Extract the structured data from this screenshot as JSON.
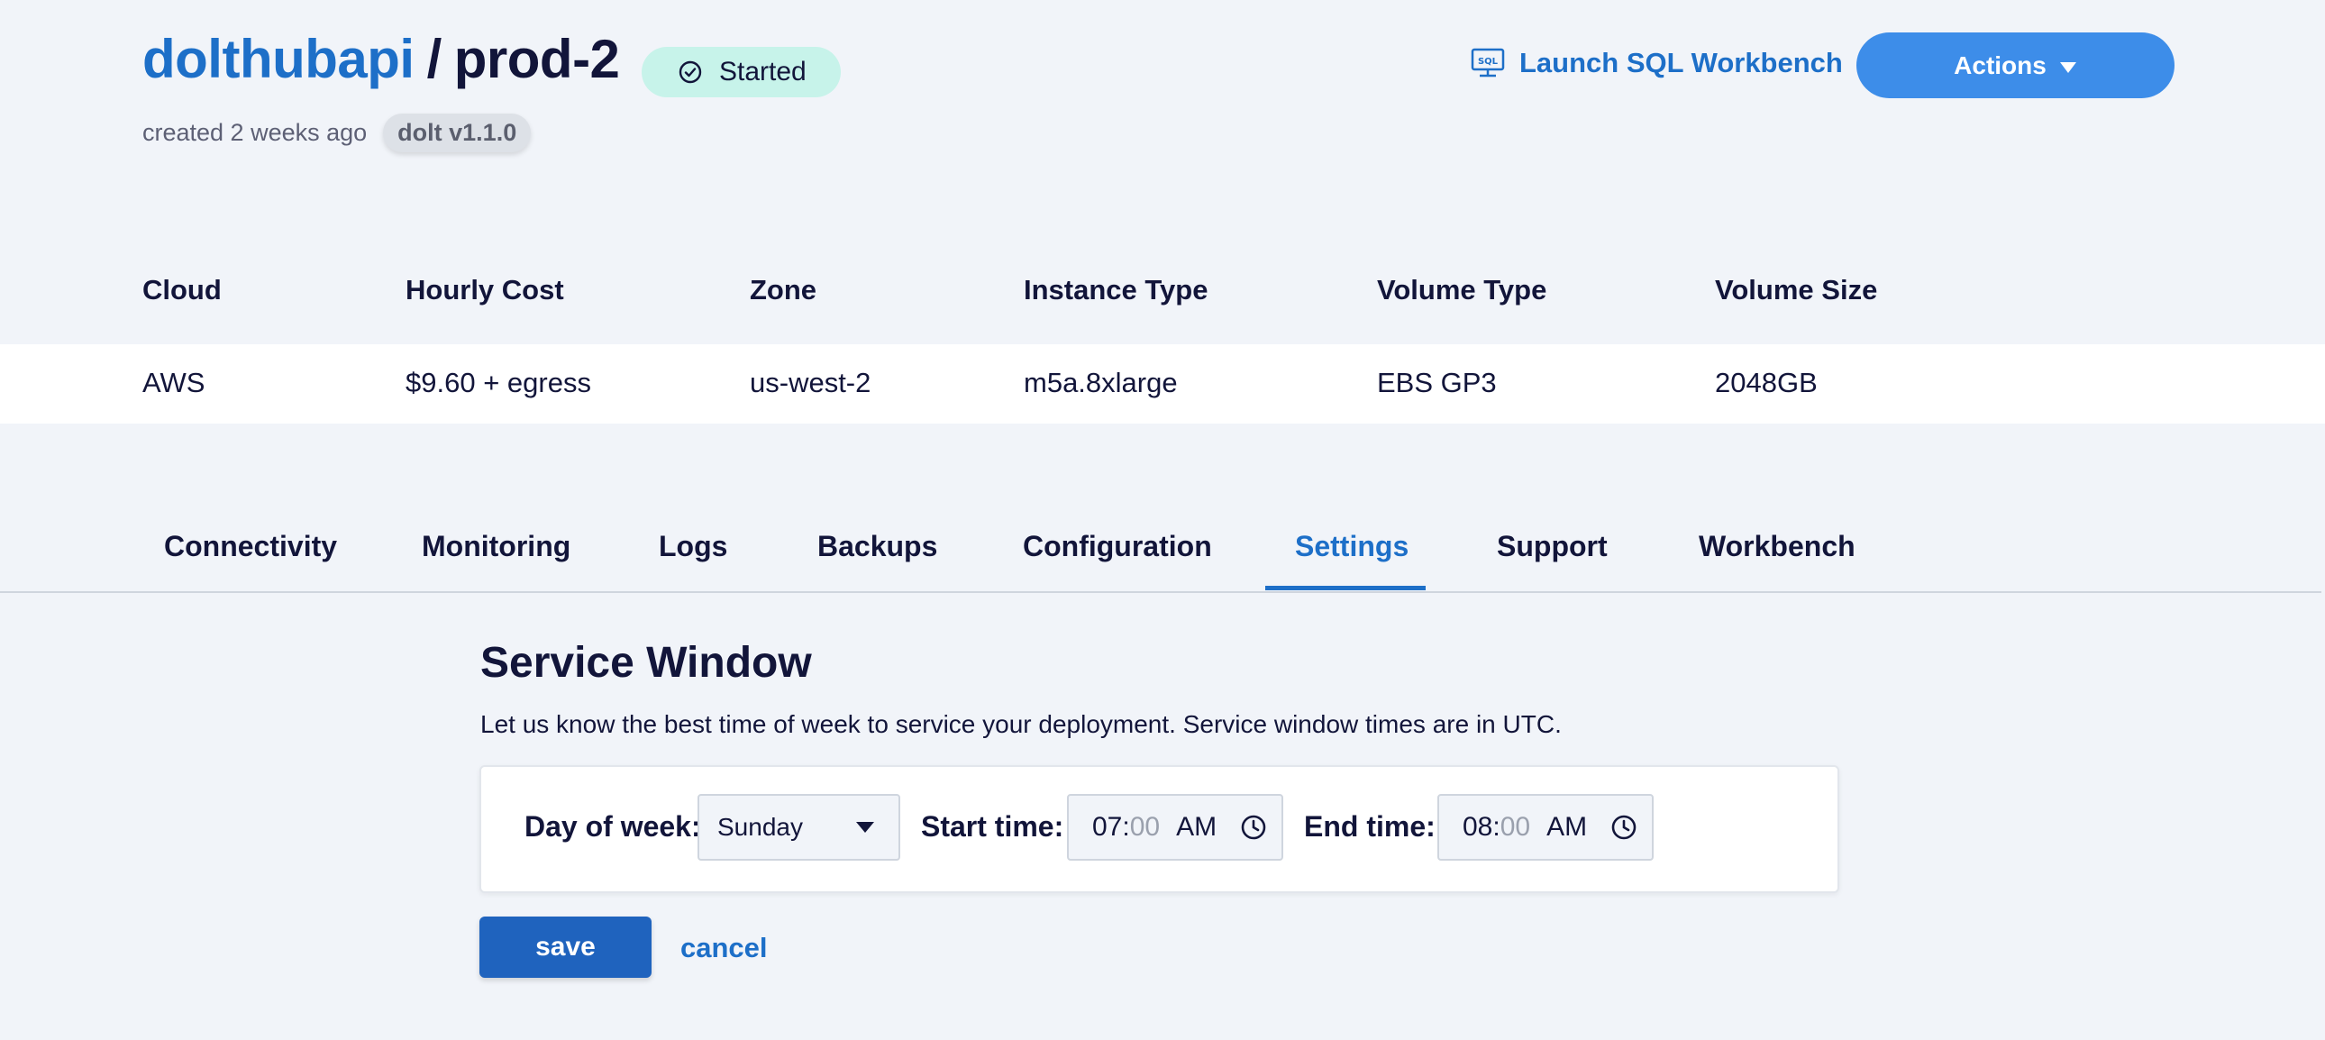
{
  "header": {
    "owner": "dolthubapi",
    "separator": "/",
    "deployment": "prod-2",
    "status": "Started",
    "created": "created 2 weeks ago",
    "version": "dolt v1.1.0",
    "launch_label": "Launch SQL Workbench",
    "actions_label": "Actions"
  },
  "info": {
    "headers": [
      "Cloud",
      "Hourly Cost",
      "Zone",
      "Instance Type",
      "Volume Type",
      "Volume Size"
    ],
    "values": [
      "AWS",
      "$9.60 + egress",
      "us-west-2",
      "m5a.8xlarge",
      "EBS GP3",
      "2048GB"
    ]
  },
  "tabs": [
    {
      "label": "Connectivity"
    },
    {
      "label": "Monitoring"
    },
    {
      "label": "Logs"
    },
    {
      "label": "Backups"
    },
    {
      "label": "Configuration"
    },
    {
      "label": "Settings"
    },
    {
      "label": "Support"
    },
    {
      "label": "Workbench"
    }
  ],
  "active_tab": "Settings",
  "service_window": {
    "title": "Service Window",
    "description": "Let us know the best time of week to service your deployment. Service window times are in UTC.",
    "day_label": "Day of week:",
    "day_value": "Sunday",
    "start_label": "Start time:",
    "start_hour": "07",
    "start_minutes": "00",
    "start_ampm": "AM",
    "end_label": "End time:",
    "end_hour": "08",
    "end_minutes": "00",
    "end_ampm": "AM",
    "save_label": "save",
    "cancel_label": "cancel"
  },
  "colors": {
    "background": "#f1f4f9",
    "accent": "#1d6fc8",
    "actions_button": "#3d8de9",
    "save_button": "#1f63be",
    "status_badge": "#c7f3ea"
  },
  "icons": {
    "status": "check-circle-icon",
    "launch": "sql-monitor-icon",
    "actions": "caret-down-icon",
    "select": "caret-down-icon",
    "time": "clock-icon"
  }
}
